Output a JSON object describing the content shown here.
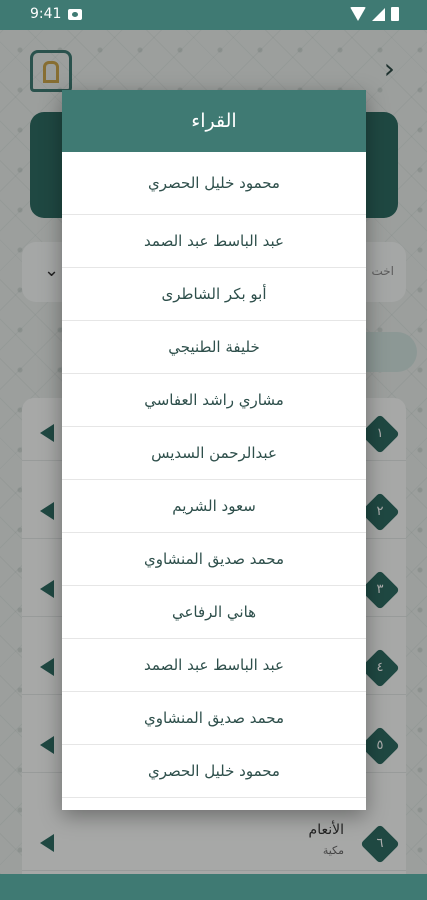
{
  "status_bar": {
    "time": "9:41"
  },
  "dialog": {
    "title": "القراء",
    "reciters": [
      "محمود خليل الحصري",
      "عبد الباسط عبد الصمد",
      "أبو بكر الشاطرى",
      "خليفة الطنيجي",
      "مشاري راشد العفاسي",
      "عبدالرحمن السديس",
      "سعود الشريم",
      "محمد صديق المنشاوي",
      "هاني الرفاعي",
      "عبد الباسط عبد الصمد",
      "محمد صديق المنشاوي",
      "محمود خليل الحصري"
    ]
  },
  "background": {
    "select_placeholder": "اخت",
    "rows": [
      {
        "num": "١"
      },
      {
        "num": "٢"
      },
      {
        "num": "٣"
      },
      {
        "num": "٤"
      },
      {
        "num": "٥"
      },
      {
        "num": "٦",
        "title": "الأنعام",
        "subtitle": "مكية"
      }
    ]
  },
  "colors": {
    "primary": "#3f7a73",
    "text": "#2e4f4b"
  }
}
